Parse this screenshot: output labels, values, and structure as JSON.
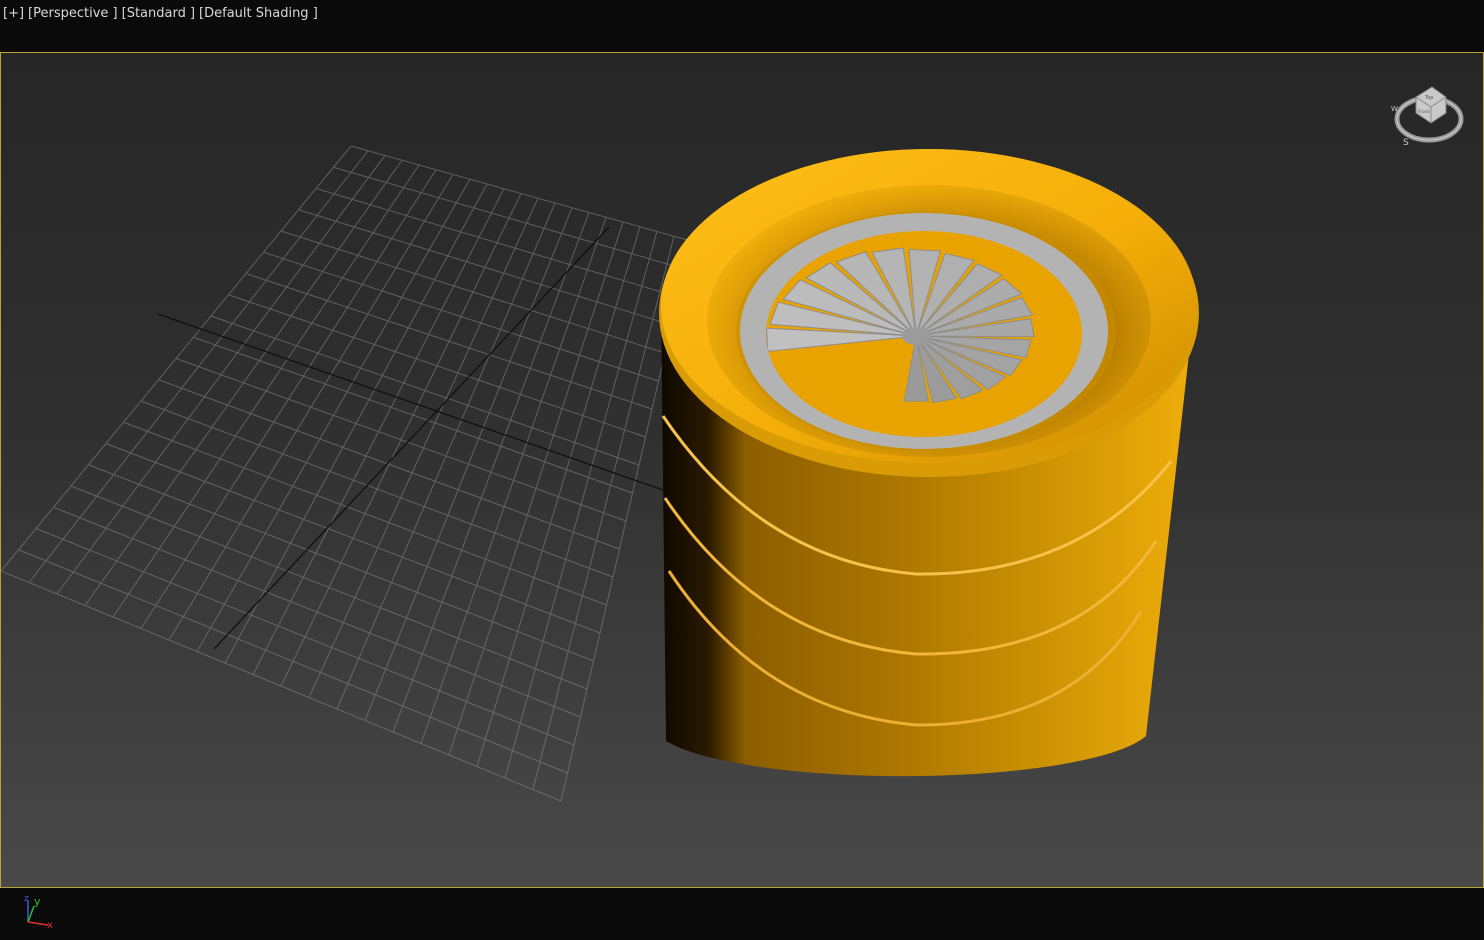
{
  "viewport": {
    "plus_label": "[+]",
    "view_label": "[Perspective ]",
    "mode_label": "[Standard ]",
    "shading_label": "[Default Shading ]",
    "border_color": "#b9a43a"
  },
  "viewcube": {
    "face_label": "Top",
    "front_label": "Front",
    "compass_south": "S",
    "compass_west": "W"
  },
  "axis_tripod": {
    "x_label": "x",
    "y_label": "y",
    "z_label": "z",
    "x_color": "#e03030",
    "y_color": "#30c030",
    "z_color": "#3060e0"
  },
  "scene": {
    "object_name": "spiral-staircase-tower",
    "object_color": "#f3ae0a",
    "stair_color": "#b8b8b8",
    "grid_color": "#8a8a8a"
  }
}
